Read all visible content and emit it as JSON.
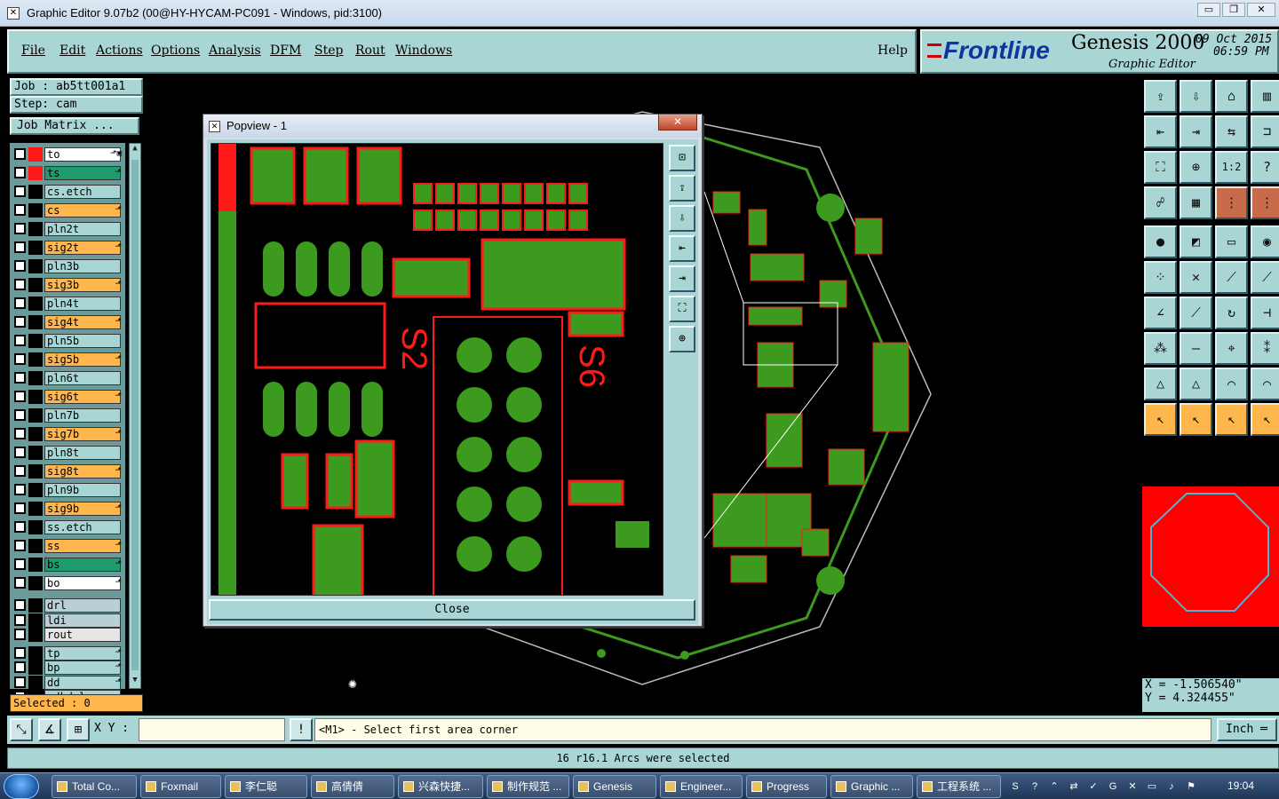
{
  "window": {
    "title": "Graphic Editor 9.07b2 (00@HY-HYCAM-PC091 - Windows, pid:3100)",
    "minimize": "▭",
    "restore": "❐",
    "close": "✕"
  },
  "menu": {
    "items": [
      "File",
      "Edit",
      "Actions",
      "Options",
      "Analysis",
      "DFM",
      "Step",
      "Rout",
      "Windows"
    ],
    "help": "Help"
  },
  "brand": {
    "logo": "Frontline",
    "product": "Genesis 2000",
    "subtitle": "Graphic Editor",
    "date": "09 Oct 2015",
    "time": "06:59 PM"
  },
  "job": {
    "job_label": "Job : ab5tt001a1",
    "step_label": "Step: cam",
    "matrix_button": "Job Matrix ..."
  },
  "layers": [
    {
      "name": "to",
      "color": "#ffffff",
      "flag": "⬏▣",
      "checked": false,
      "affected": true
    },
    {
      "name": "ts",
      "color": "#1f9c6e",
      "flag": "⬏",
      "checked": false,
      "affected": true
    },
    {
      "name": "cs.etch",
      "color": "#a9d5d5",
      "flag": "",
      "checked": false
    },
    {
      "name": "cs",
      "color": "#ffb64c",
      "flag": "⬏",
      "checked": false
    },
    {
      "name": "pln2t",
      "color": "#a9d5d5",
      "flag": "",
      "checked": false
    },
    {
      "name": "sig2t",
      "color": "#ffb64c",
      "flag": "⬏",
      "checked": false
    },
    {
      "name": "pln3b",
      "color": "#a9d5d5",
      "flag": "",
      "checked": false
    },
    {
      "name": "sig3b",
      "color": "#ffb64c",
      "flag": "⬏",
      "checked": false
    },
    {
      "name": "pln4t",
      "color": "#a9d5d5",
      "flag": "",
      "checked": false
    },
    {
      "name": "sig4t",
      "color": "#ffb64c",
      "flag": "⬏",
      "checked": false
    },
    {
      "name": "pln5b",
      "color": "#a9d5d5",
      "flag": "",
      "checked": false
    },
    {
      "name": "sig5b",
      "color": "#ffb64c",
      "flag": "⬏",
      "checked": false
    },
    {
      "name": "pln6t",
      "color": "#a9d5d5",
      "flag": "",
      "checked": false
    },
    {
      "name": "sig6t",
      "color": "#ffb64c",
      "flag": "⬏",
      "checked": false
    },
    {
      "name": "pln7b",
      "color": "#a9d5d5",
      "flag": "",
      "checked": false
    },
    {
      "name": "sig7b",
      "color": "#ffb64c",
      "flag": "⬏",
      "checked": false
    },
    {
      "name": "pln8t",
      "color": "#a9d5d5",
      "flag": "",
      "checked": false
    },
    {
      "name": "sig8t",
      "color": "#ffb64c",
      "flag": "⬏",
      "checked": false
    },
    {
      "name": "pln9b",
      "color": "#a9d5d5",
      "flag": "",
      "checked": false
    },
    {
      "name": "sig9b",
      "color": "#ffb64c",
      "flag": "⬏",
      "checked": false
    },
    {
      "name": "ss.etch",
      "color": "#a9d5d5",
      "flag": "",
      "checked": false
    },
    {
      "name": "ss",
      "color": "#ffb64c",
      "flag": "⬏",
      "checked": false
    },
    {
      "name": "bs",
      "color": "#1f9c6e",
      "flag": "⬏",
      "checked": false
    },
    {
      "name": "bo",
      "color": "#ffffff",
      "flag": "⬏",
      "checked": false
    },
    {
      "name": "drl",
      "color": "#b9cfd6",
      "flag": "",
      "checked": false
    },
    {
      "name": "ldi",
      "color": "#b9cfd6",
      "flag": "",
      "checked": false
    },
    {
      "name": "rout",
      "color": "#e6e6e6",
      "flag": "",
      "checked": false
    },
    {
      "name": "tp",
      "color": "#a9d5d5",
      "flag": "⬏",
      "checked": false
    },
    {
      "name": "bp",
      "color": "#a9d5d5",
      "flag": "⬏",
      "checked": false
    },
    {
      "name": "dd",
      "color": "#a9d5d5",
      "flag": "⬏",
      "checked": false
    },
    {
      "name": "ydkdrl",
      "color": "#a9d5d5",
      "flag": "",
      "checked": false
    }
  ],
  "selected_label": "Selected : 0",
  "tools": [
    {
      "icon": "export-icon",
      "glyph": "⇪"
    },
    {
      "icon": "import-icon",
      "glyph": "⇩"
    },
    {
      "icon": "home-icon",
      "glyph": "⌂"
    },
    {
      "icon": "layout-icon",
      "glyph": "▥"
    },
    {
      "icon": "pan-left-icon",
      "glyph": "⇤"
    },
    {
      "icon": "pan-right-icon",
      "glyph": "⇥"
    },
    {
      "icon": "pan-both-icon",
      "glyph": "⇆"
    },
    {
      "icon": "arc-icon",
      "glyph": "⊐"
    },
    {
      "icon": "zoom-fit-icon",
      "glyph": "⛶"
    },
    {
      "icon": "zoom-center-icon",
      "glyph": "⊕"
    },
    {
      "icon": "scale-icon",
      "glyph": "1:2"
    },
    {
      "icon": "help-icon",
      "glyph": "?"
    },
    {
      "icon": "route-icon",
      "glyph": "☍"
    },
    {
      "icon": "grid-icon",
      "glyph": "▦"
    },
    {
      "icon": "connect-icon",
      "glyph": "⋮"
    },
    {
      "icon": "connect2-icon",
      "glyph": "⋮"
    },
    {
      "icon": "pad-icon",
      "glyph": "●"
    },
    {
      "icon": "flip-icon",
      "glyph": "◩"
    },
    {
      "icon": "ruler-icon",
      "glyph": "▭"
    },
    {
      "icon": "circle-icon",
      "glyph": "◉"
    },
    {
      "icon": "node-icon",
      "glyph": "⁘"
    },
    {
      "icon": "cross-icon",
      "glyph": "✕"
    },
    {
      "icon": "line-icon",
      "glyph": "⟋"
    },
    {
      "icon": "line2-icon",
      "glyph": "⟋"
    },
    {
      "icon": "angle-icon",
      "glyph": "∠"
    },
    {
      "icon": "slope-icon",
      "glyph": "⟋"
    },
    {
      "icon": "rotate-icon",
      "glyph": "↻"
    },
    {
      "icon": "mirror-icon",
      "glyph": "⊣"
    },
    {
      "icon": "group-icon",
      "glyph": "⁂"
    },
    {
      "icon": "minus-icon",
      "glyph": "—"
    },
    {
      "icon": "target-icon",
      "glyph": "⌖"
    },
    {
      "icon": "cluster-icon",
      "glyph": "⁑"
    },
    {
      "icon": "triangle-icon",
      "glyph": "△"
    },
    {
      "icon": "triangle2-icon",
      "glyph": "△"
    },
    {
      "icon": "arch-icon",
      "glyph": "⌒"
    },
    {
      "icon": "arch2-icon",
      "glyph": "⌒"
    },
    {
      "icon": "pointer-icon",
      "glyph": "↖"
    },
    {
      "icon": "pointer-box-icon",
      "glyph": "↖"
    },
    {
      "icon": "pointer-plus-icon",
      "glyph": "↖"
    },
    {
      "icon": "pointer-route-icon",
      "glyph": "↖"
    }
  ],
  "coords": {
    "x": "X = -1.506540\"",
    "y": "Y = 4.324455\""
  },
  "bottom": {
    "xy_label": "X Y :",
    "xy_value": "",
    "prompt": "<M1> - Select first area corner",
    "units": "Inch ═",
    "status": "16 r16.1 Arcs were selected"
  },
  "popview": {
    "title": "Popview - 1",
    "close_x": "✕",
    "close_button": "Close",
    "silk_a": "S2",
    "silk_b": "S6"
  },
  "taskbar": {
    "tasks": [
      "Total Co...",
      "Foxmail",
      "李仁聪",
      "高倩倩",
      "兴森快捷...",
      "制作规范 ...",
      "Genesis",
      "Engineer...",
      "Progress",
      "Graphic ...",
      "工程系统 ..."
    ],
    "clock": "19:04"
  },
  "colors": {
    "panel": "#a9d5d5",
    "copper": "#3c9a1e",
    "outline": "#ff1a1a",
    "accent_orange": "#ffb64c"
  }
}
